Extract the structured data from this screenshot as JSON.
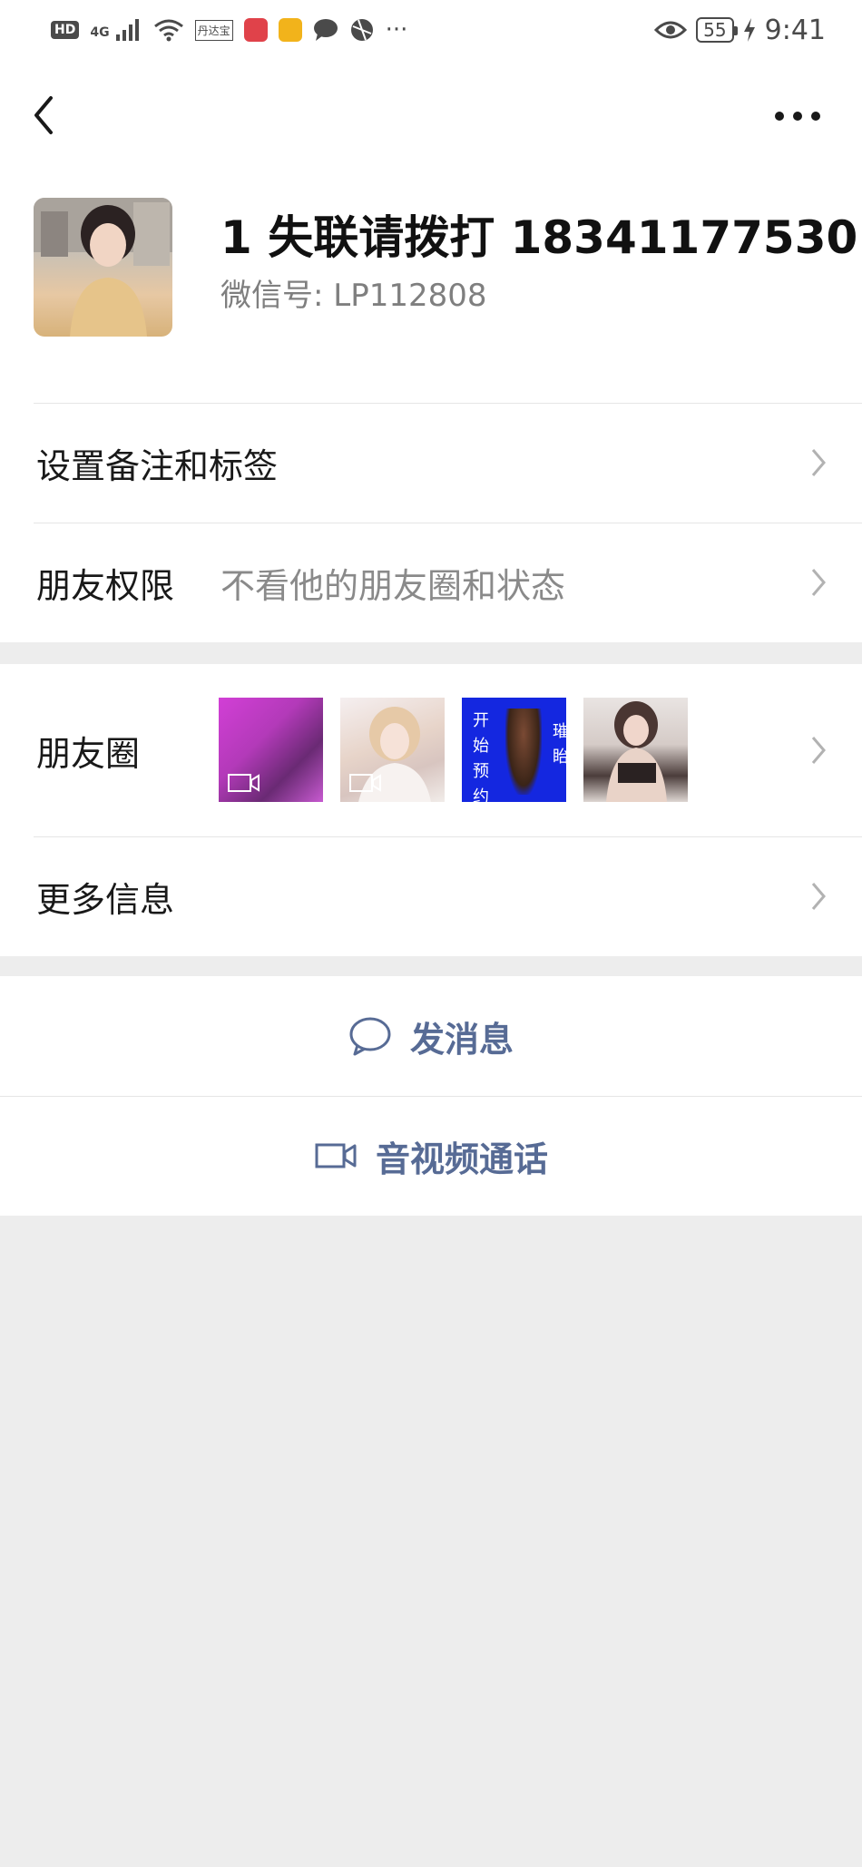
{
  "status_bar": {
    "hd": "HD",
    "network": "4G",
    "app_badge": "丹达宝",
    "overflow": "···",
    "battery": "55",
    "time": "9:41"
  },
  "profile": {
    "name": "1 失联请拨打 18341177530",
    "wechat_id": "微信号:  LP112808"
  },
  "rows": {
    "remark": {
      "label": "设置备注和标签"
    },
    "permissions": {
      "label": "朋友权限",
      "value": "不看他的朋友圈和状态"
    },
    "moments": {
      "label": "朋友圈",
      "thumb_text_left": "开始预约",
      "thumb_text_right": "璀眙"
    },
    "more_info": {
      "label": "更多信息"
    }
  },
  "actions": {
    "send_message": "发消息",
    "av_call": "音视频通话"
  },
  "colors": {
    "link": "#576b95",
    "page_bg": "#ededed"
  }
}
